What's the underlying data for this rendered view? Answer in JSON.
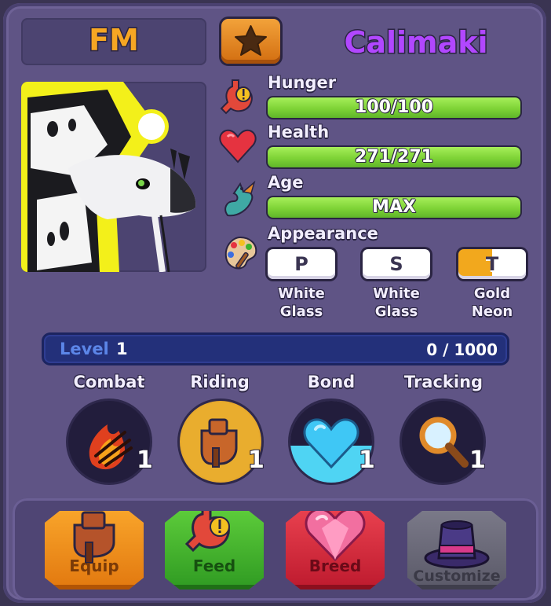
{
  "header": {
    "short_name": "FM",
    "pet_name": "Calimaki",
    "favorite_icon": "star-icon"
  },
  "stats": {
    "hunger": {
      "label": "Hunger",
      "value": "100/100",
      "fraction": 1.0,
      "icon": "stomach-icon"
    },
    "health": {
      "label": "Health",
      "value": "271/271",
      "fraction": 1.0,
      "icon": "heart-icon"
    },
    "age": {
      "label": "Age",
      "value": "MAX",
      "fraction": 1.0,
      "icon": "dragon-icon"
    },
    "appearance": {
      "label": "Appearance",
      "icon": "palette-icon"
    }
  },
  "appearance_slots": [
    {
      "letter": "P",
      "line1": "White",
      "line2": "Glass",
      "color": "#ffffff"
    },
    {
      "letter": "S",
      "line1": "White",
      "line2": "Glass",
      "color": "#ffffff"
    },
    {
      "letter": "T",
      "line1": "Gold",
      "line2": "Neon",
      "color": "#f2a81d"
    }
  ],
  "level": {
    "label": "Level",
    "value": "1",
    "xp": "0 / 1000",
    "fraction": 0.0
  },
  "skills": [
    {
      "label": "Combat",
      "level": "1",
      "icon": "fire-claw-icon"
    },
    {
      "label": "Riding",
      "level": "1",
      "icon": "saddle-icon"
    },
    {
      "label": "Bond",
      "level": "1",
      "icon": "heart-icon"
    },
    {
      "label": "Tracking",
      "level": "1",
      "icon": "magnifier-icon"
    }
  ],
  "actions": [
    {
      "label": "Equip",
      "icon": "saddle-icon",
      "color": "#f08a1c"
    },
    {
      "label": "Feed",
      "icon": "stomach-icon",
      "color": "#3cb32c"
    },
    {
      "label": "Breed",
      "icon": "heart-gem-icon",
      "color": "#d8233a"
    },
    {
      "label": "Customize",
      "icon": "top-hat-icon",
      "color": "#6b6a78"
    }
  ],
  "colors": {
    "panel": "#5f5485",
    "bar_fill": "#7ed336",
    "title_orange": "#f6a623",
    "name_purple": "#b147ff",
    "level_bar": "#23307a"
  }
}
